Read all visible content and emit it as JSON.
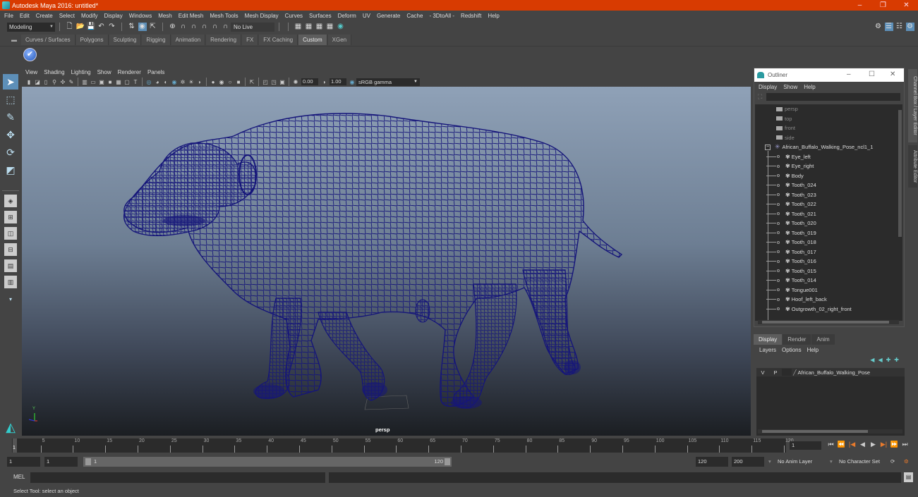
{
  "window": {
    "title": "Autodesk Maya 2016: untitled*",
    "controls": [
      "–",
      "❐",
      "✕"
    ]
  },
  "menubar": [
    "File",
    "Edit",
    "Create",
    "Select",
    "Modify",
    "Display",
    "Windows",
    "Mesh",
    "Edit Mesh",
    "Mesh Tools",
    "Mesh Display",
    "Curves",
    "Surfaces",
    "Deform",
    "UV",
    "Generate",
    "Cache",
    "- 3DtoAll -",
    "Redshift",
    "Help"
  ],
  "toolbar": {
    "mode": "Modeling",
    "live_surface": "No Live Surface"
  },
  "shelf": {
    "tabs": [
      "Curves / Surfaces",
      "Polygons",
      "Sculpting",
      "Rigging",
      "Animation",
      "Rendering",
      "FX",
      "FX Caching",
      "Custom",
      "XGen"
    ],
    "active_tab": "Custom"
  },
  "viewport": {
    "menu": [
      "View",
      "Shading",
      "Lighting",
      "Show",
      "Renderer",
      "Panels"
    ],
    "exposure": "0.00",
    "gamma": "1.00",
    "color_space": "sRGB gamma",
    "camera_label": "persp",
    "axis_label": "Y"
  },
  "outliner": {
    "title": "Outliner",
    "menu": [
      "Display",
      "Show",
      "Help"
    ],
    "cameras": [
      "persp",
      "top",
      "front",
      "side"
    ],
    "group": "African_Buffalo_Walking_Pose_ncl1_1",
    "children": [
      "Eye_left",
      "Eye_right",
      "Body",
      "Tooth_024",
      "Tooth_023",
      "Tooth_022",
      "Tooth_021",
      "Tooth_020",
      "Tooth_019",
      "Tooth_018",
      "Tooth_017",
      "Tooth_016",
      "Tooth_015",
      "Tooth_014",
      "Tongue001",
      "Hoof_left_back",
      "Outgrowth_02_right_front"
    ]
  },
  "side_tabs": [
    "Channel Box / Layer Editor",
    "Attribute Editor"
  ],
  "layer_editor": {
    "tabs": [
      "Display",
      "Render",
      "Anim"
    ],
    "active_tab": "Display",
    "menu": [
      "Layers",
      "Options",
      "Help"
    ],
    "layers": [
      {
        "v": "V",
        "p": "P",
        "name": "African_Buffalo_Walking_Pose"
      }
    ]
  },
  "timeline": {
    "ticks": [
      "5",
      "10",
      "15",
      "20",
      "25",
      "30",
      "35",
      "40",
      "45",
      "50",
      "55",
      "60",
      "65",
      "70",
      "75",
      "80",
      "85",
      "90",
      "95",
      "100",
      "105",
      "110",
      "115",
      "120"
    ],
    "current_frame": "1",
    "current_frame_field": "1",
    "range_start": 1,
    "range_end": 120
  },
  "range": {
    "start_field": "1",
    "playback_start": "1",
    "slider_start": "1",
    "slider_end": "120",
    "playback_end": "120",
    "end_field": "200",
    "anim_layer": "No Anim Layer",
    "character_set": "No Character Set"
  },
  "command_line": {
    "label": "MEL",
    "value": ""
  },
  "help_line": "Select Tool: select an object"
}
